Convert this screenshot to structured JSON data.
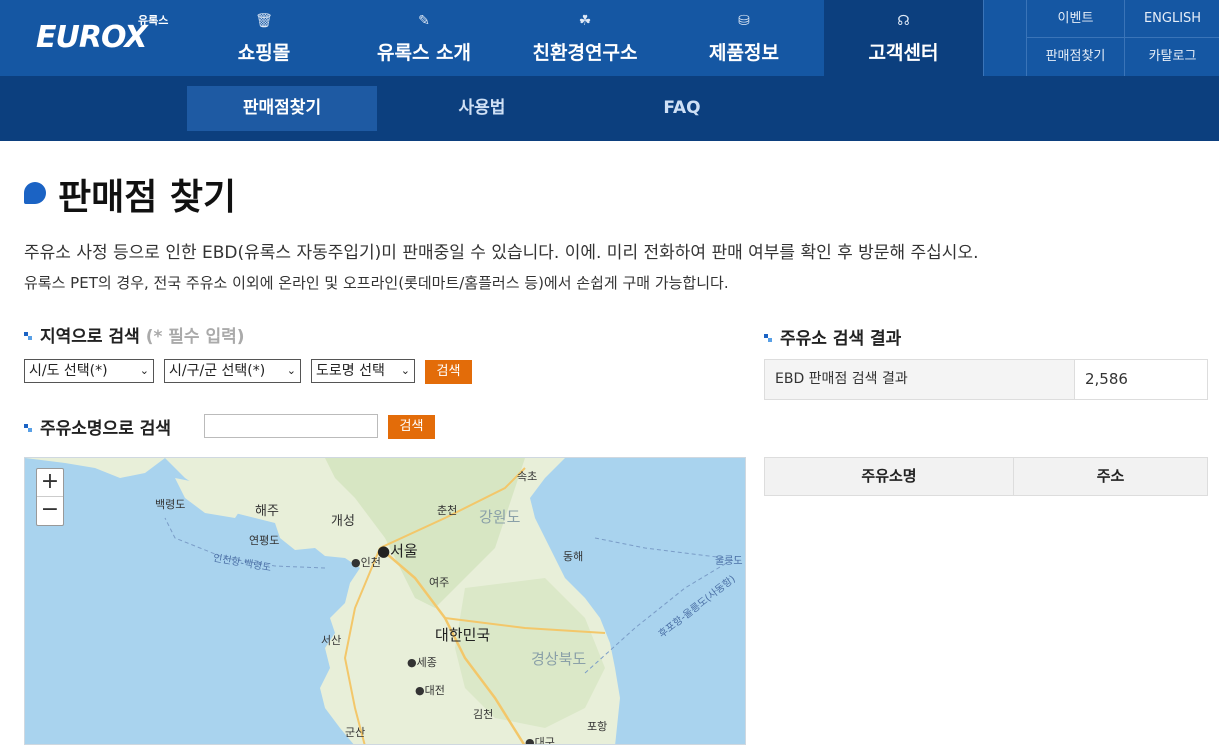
{
  "header": {
    "logo_text": "EUROX",
    "logo_sub": "유록스",
    "gnb": [
      {
        "label": "쇼핑몰",
        "icon": "basket-icon"
      },
      {
        "label": "유록스 소개",
        "icon": "pen-icon"
      },
      {
        "label": "친환경연구소",
        "icon": "leaf-icon"
      },
      {
        "label": "제품정보",
        "icon": "database-icon"
      },
      {
        "label": "고객센터",
        "icon": "headset-icon"
      }
    ],
    "util": [
      "이벤트",
      "ENGLISH",
      "판매점찾기",
      "카탈로그"
    ]
  },
  "subnav": [
    "판매점찾기",
    "사용법",
    "FAQ"
  ],
  "page": {
    "title": "판매점 찾기",
    "desc1": "주유소 사정 등으로 인한 EBD(유록스 자동주입기)미 판매중일 수 있습니다. 이에. 미리 전화하여 판매 여부를 확인 후 방문해 주십시오.",
    "desc2": "유록스 PET의 경우, 전국 주유소 이외에 온라인 및 오프라인(롯데마트/홈플러스 등)에서 손쉽게 구매 가능합니다."
  },
  "region_search": {
    "heading": "지역으로 검색",
    "required": "(* 필수 입력)",
    "select1": "시/도 선택(*)",
    "select2": "시/구/군 선택(*)",
    "select3": "도로명 선택",
    "button": "검색"
  },
  "name_search": {
    "heading": "주유소명으로 검색",
    "value": "",
    "button": "검색"
  },
  "map": {
    "zoom_in": "+",
    "zoom_out": "−",
    "labels": {
      "sokcho": "속초",
      "baengnyeong": "백령도",
      "haeju": "해주",
      "kaesong": "개성",
      "chuncheon": "춘천",
      "gangwon": "강원도",
      "yeonpyeong": "연평도",
      "seoul": "서울",
      "incheon": "인천",
      "donghae": "동해",
      "ulleung": "울릉도",
      "route1": "인천항-백령도",
      "yeoju": "여주",
      "seosan": "서산",
      "korea": "대한민국",
      "gyeongbuk": "경상북도",
      "sejong": "세종",
      "daejeon": "대전",
      "gimcheon": "김천",
      "pohang": "포항",
      "gunsan": "군산",
      "daegu": "대구",
      "route2": "후포항-울릉도(사동항)"
    }
  },
  "results": {
    "heading": "주유소 검색 결과",
    "label": "EBD 판매점 검색 결과",
    "count": "2,586",
    "col1": "주유소명",
    "col2": "주소"
  }
}
